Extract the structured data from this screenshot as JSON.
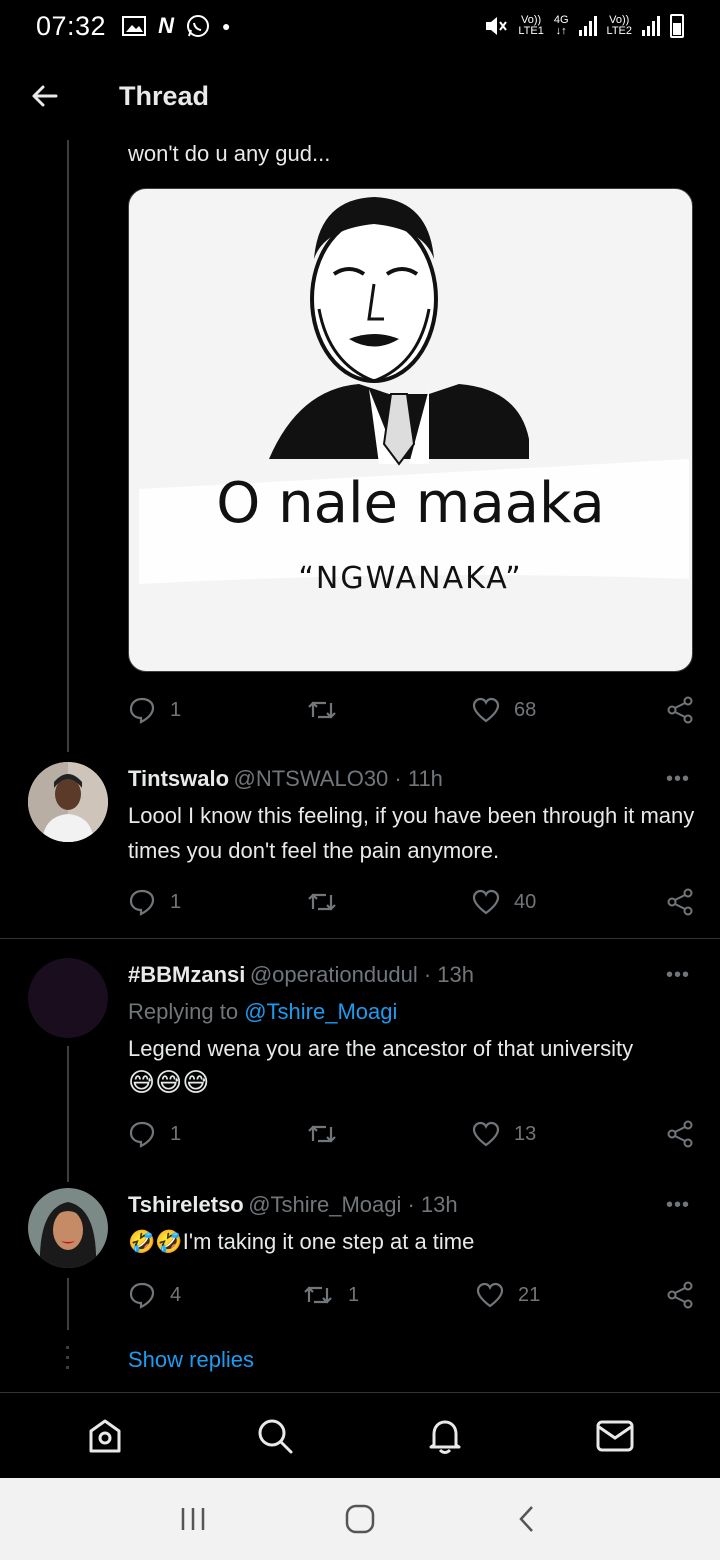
{
  "status_bar": {
    "time": "07:32",
    "net1_top": "Vo))",
    "net1_bottom": "LTE1",
    "net_type": "4G",
    "net2_top": "Vo))",
    "net2_bottom": "LTE2"
  },
  "header": {
    "title": "Thread"
  },
  "tweet_main": {
    "text_tail": "won't do u any gud...",
    "meme_line1": "O nale maaka",
    "meme_line2": "“NGWANAKA”",
    "replies": "1",
    "retweets": "",
    "likes": "68"
  },
  "tweet_tintswalo": {
    "name": "Tintswalo",
    "handle": "@NTSWALO30 · 11h",
    "text": "Loool I know this feeling, if you have been through it many times you don't feel the pain anymore.",
    "replies": "1",
    "retweets": "",
    "likes": "40"
  },
  "tweet_bbm": {
    "name": "#BBMzansi",
    "handle": "@operationdudul · 13h",
    "replying_prefix": "Replying to",
    "replying_to": "@Tshire_Moagi",
    "text": "Legend wena you are the ancestor of that university",
    "emojis": "😅😅😅",
    "replies": "1",
    "retweets": "",
    "likes": "13"
  },
  "tweet_tshire": {
    "name": "Tshireletso",
    "handle": "@Tshire_Moagi · 13h",
    "emojis": "🤣🤣",
    "text": "I'm taking it one step at a time",
    "replies": "4",
    "retweets": "1",
    "likes": "21"
  },
  "show_replies": "Show replies",
  "more_glyph": "•••",
  "colors": {
    "link": "#1d9bf0",
    "muted": "#71767b",
    "background": "#000000"
  }
}
